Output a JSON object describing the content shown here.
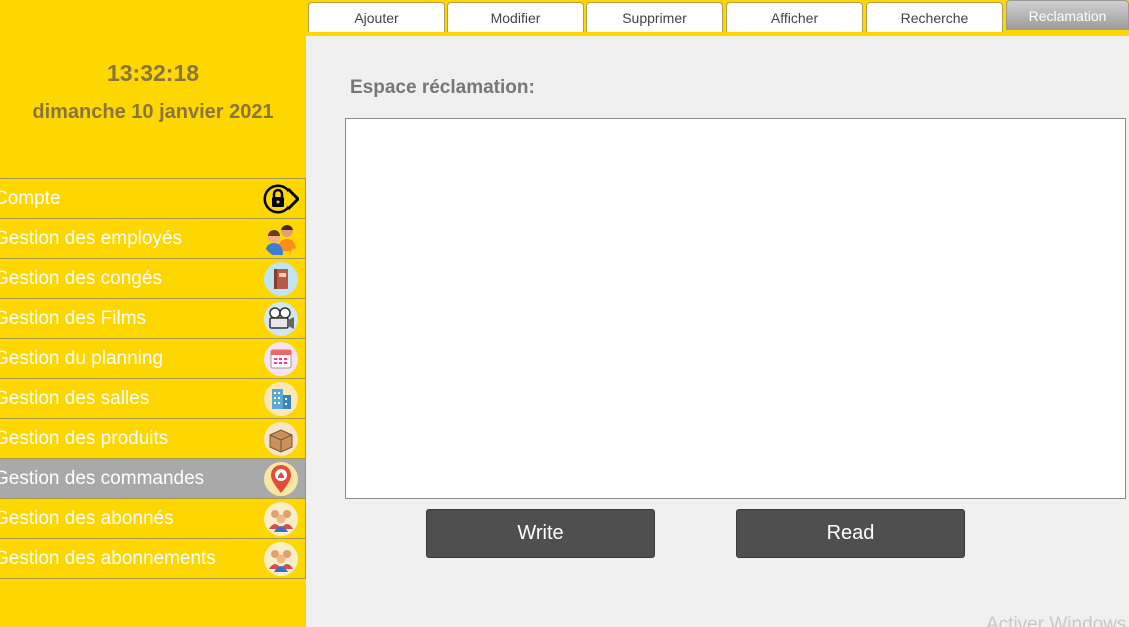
{
  "sidebar": {
    "clock": "13:32:18",
    "date": "dimanche 10 janvier 2021",
    "items": [
      {
        "label": "Compte",
        "icon": "lock-icon"
      },
      {
        "label": "Gestion des employés",
        "icon": "employees-icon"
      },
      {
        "label": "Gestion des congés",
        "icon": "book-icon"
      },
      {
        "label": "Gestion des Films",
        "icon": "film-camera-icon"
      },
      {
        "label": "Gestion du planning",
        "icon": "calendar-icon"
      },
      {
        "label": "Gestion des salles",
        "icon": "building-icon"
      },
      {
        "label": "Gestion des produits",
        "icon": "box-icon"
      },
      {
        "label": "Gestion des commandes",
        "icon": "location-pin-icon"
      },
      {
        "label": "Gestion des abonnés",
        "icon": "group-icon"
      },
      {
        "label": "Gestion des abonnements",
        "icon": "group-icon"
      }
    ],
    "active_index": 7
  },
  "tabs": [
    {
      "label": "Ajouter"
    },
    {
      "label": "Modifier"
    },
    {
      "label": "Supprimer"
    },
    {
      "label": "Afficher"
    },
    {
      "label": "Recherche"
    },
    {
      "label": "Reclamation"
    }
  ],
  "active_tab": "Reclamation",
  "main": {
    "title": "Espace réclamation:",
    "text_value": "",
    "write_label": "Write",
    "read_label": "Read"
  },
  "watermark": "Activer Windows",
  "colors": {
    "sidebar_bg": "#ffd700",
    "active_item_bg": "#a9a9a9",
    "button_bg": "#4f4f4f",
    "content_bg": "#f0f0f0"
  }
}
